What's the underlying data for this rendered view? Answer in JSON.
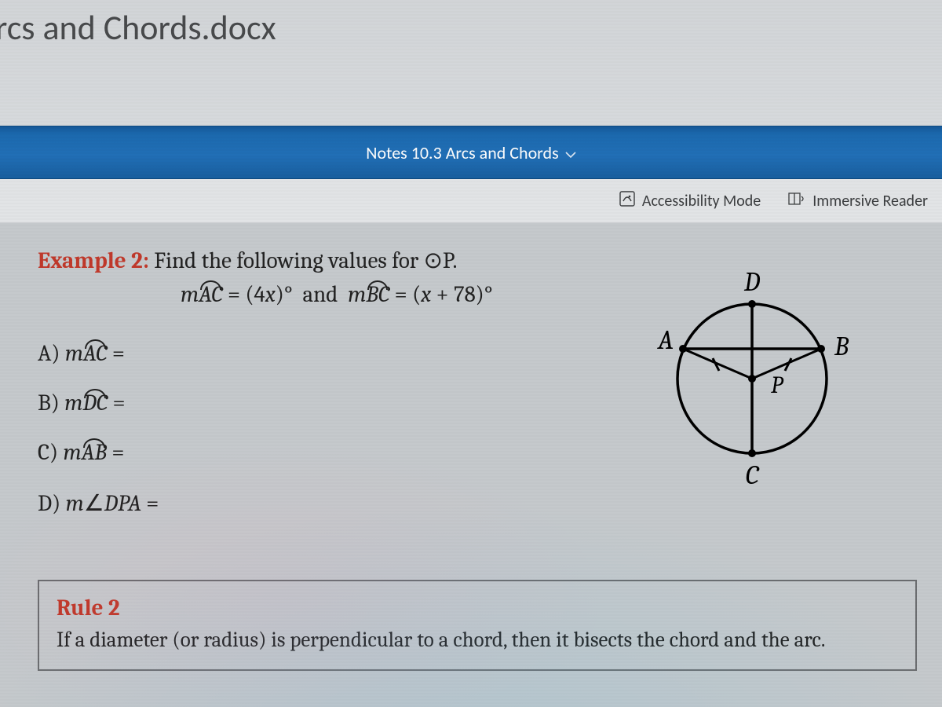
{
  "header": {
    "doc_title": "rcs and Chords.docx"
  },
  "ribbon": {
    "dropdown_label": "Notes 10.3 Arcs and Chords"
  },
  "toolbar": {
    "accessibility": "Accessibility Mode",
    "immersive": "Immersive Reader"
  },
  "example": {
    "label": "Example 2:",
    "prompt": "Find the following values for ⊙P.",
    "given_1": "mÂC = (4x)°",
    "given_join": "and",
    "given_2": "mB̂C = (x + 78)°",
    "questions": {
      "a": "A) mÂC =",
      "b": "B) mD̂C =",
      "c": "C) mÂB =",
      "d": "D) m∠DPA ="
    },
    "diagram_labels": {
      "A": "A",
      "B": "B",
      "C": "C",
      "D": "D",
      "P": "P"
    }
  },
  "rule": {
    "title": "Rule 2",
    "text": "If a diameter (or radius) is perpendicular to a chord, then it bisects the chord and the arc."
  }
}
